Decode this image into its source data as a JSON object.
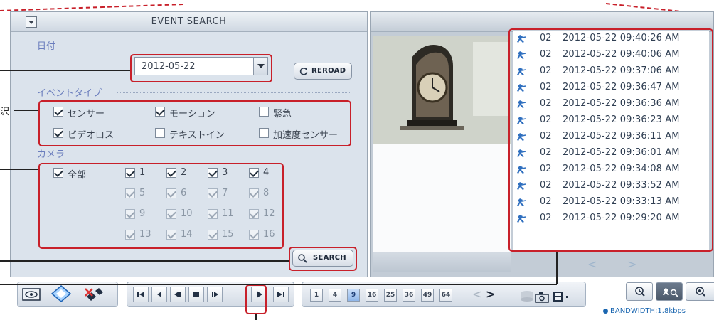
{
  "panel": {
    "title": "EVENT SEARCH"
  },
  "sections": {
    "date": "日付",
    "event_type": "イベントタイプ",
    "camera": "カメラ"
  },
  "date_select": {
    "value": "2012-05-22"
  },
  "buttons": {
    "reload": "REROAD",
    "search": "SEARCH"
  },
  "event_types": [
    {
      "label": "センサー",
      "checked": true
    },
    {
      "label": "モーション",
      "checked": true
    },
    {
      "label": "緊急",
      "checked": false
    },
    {
      "label": "ビデオロス",
      "checked": true
    },
    {
      "label": "テキストイン",
      "checked": false
    },
    {
      "label": "加速度センサー",
      "checked": false
    }
  ],
  "cameras": {
    "all_label": "全部",
    "items": [
      {
        "label": "1",
        "checked": true,
        "enabled": true
      },
      {
        "label": "2",
        "checked": true,
        "enabled": true
      },
      {
        "label": "3",
        "checked": true,
        "enabled": true
      },
      {
        "label": "4",
        "checked": true,
        "enabled": true
      },
      {
        "label": "5",
        "checked": true,
        "enabled": false
      },
      {
        "label": "6",
        "checked": true,
        "enabled": false
      },
      {
        "label": "7",
        "checked": true,
        "enabled": false
      },
      {
        "label": "8",
        "checked": true,
        "enabled": false
      },
      {
        "label": "9",
        "checked": true,
        "enabled": false
      },
      {
        "label": "10",
        "checked": true,
        "enabled": false
      },
      {
        "label": "11",
        "checked": true,
        "enabled": false
      },
      {
        "label": "12",
        "checked": true,
        "enabled": false
      },
      {
        "label": "13",
        "checked": true,
        "enabled": false
      },
      {
        "label": "14",
        "checked": true,
        "enabled": false
      },
      {
        "label": "15",
        "checked": true,
        "enabled": false
      },
      {
        "label": "16",
        "checked": true,
        "enabled": false
      }
    ]
  },
  "events": [
    {
      "camera": "02",
      "time": "2012-05-22 09:40:26 AM"
    },
    {
      "camera": "02",
      "time": "2012-05-22 09:40:06 AM"
    },
    {
      "camera": "02",
      "time": "2012-05-22 09:37:06 AM"
    },
    {
      "camera": "02",
      "time": "2012-05-22 09:36:47 AM"
    },
    {
      "camera": "02",
      "time": "2012-05-22 09:36:36 AM"
    },
    {
      "camera": "02",
      "time": "2012-05-22 09:36:23 AM"
    },
    {
      "camera": "02",
      "time": "2012-05-22 09:36:11 AM"
    },
    {
      "camera": "02",
      "time": "2012-05-22 09:36:01 AM"
    },
    {
      "camera": "02",
      "time": "2012-05-22 09:34:08 AM"
    },
    {
      "camera": "02",
      "time": "2012-05-22 09:33:52 AM"
    },
    {
      "camera": "02",
      "time": "2012-05-22 09:33:13 AM"
    },
    {
      "camera": "02",
      "time": "2012-05-22 09:29:20 AM"
    }
  ],
  "list_nav": {
    "prev": "<",
    "next": ">"
  },
  "channel_layouts": [
    "1",
    "4",
    "9",
    "16",
    "25",
    "36",
    "49",
    "64"
  ],
  "layout_nav": {
    "prev": "<",
    "next": ">"
  },
  "status": {
    "bandwidth": "BANDWIDTH:1.8kbps"
  },
  "annotation_fragment": "沢",
  "colors": {
    "highlight": "#c8202a",
    "panel": "#dbe3ec",
    "accent": "#1a66b0",
    "event_text": "#2f3e52"
  }
}
